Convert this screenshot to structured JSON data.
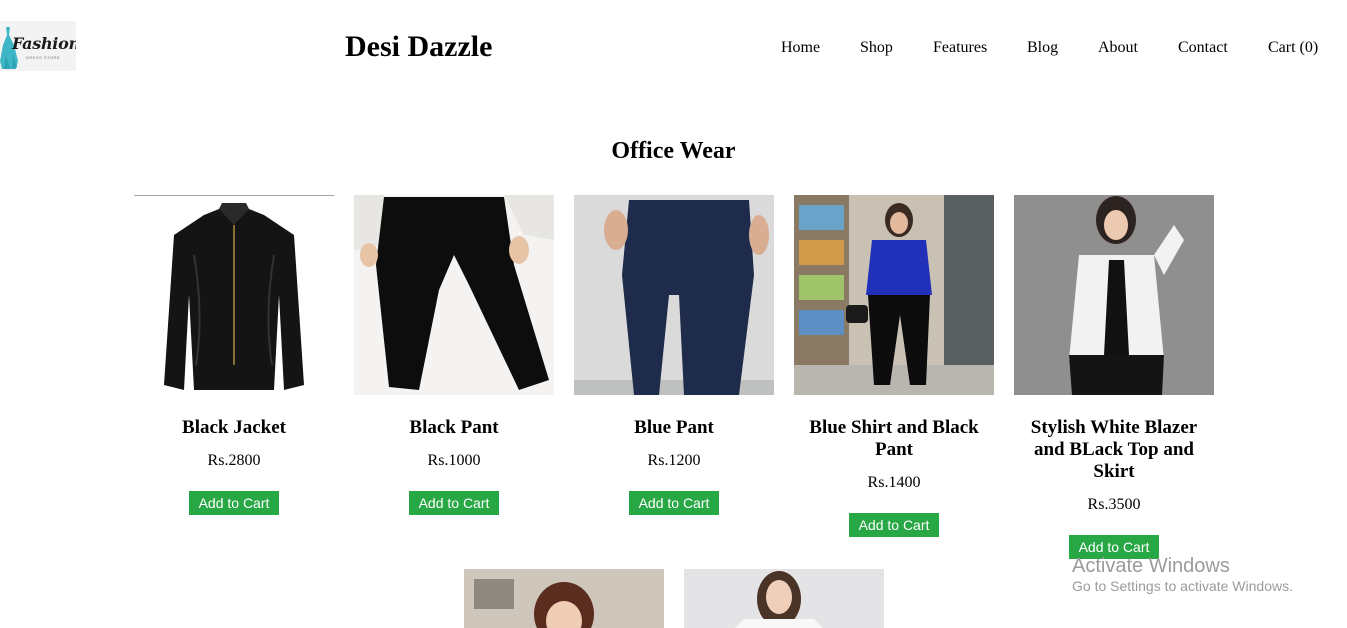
{
  "header": {
    "logo_text": "Fashion",
    "logo_subtext": "DRESS STORE",
    "brand": "Desi Dazzle",
    "nav": [
      {
        "label": "Home"
      },
      {
        "label": "Shop"
      },
      {
        "label": "Features"
      },
      {
        "label": "Blog"
      },
      {
        "label": "About"
      },
      {
        "label": "Contact"
      },
      {
        "label": "Cart (0)"
      }
    ]
  },
  "section": {
    "title": "Office Wear",
    "products": [
      {
        "name": "Black Jacket",
        "price": "Rs.2800",
        "button": "Add to Cart"
      },
      {
        "name": "Black Pant",
        "price": "Rs.1000",
        "button": "Add to Cart"
      },
      {
        "name": "Blue Pant",
        "price": "Rs.1200",
        "button": "Add to Cart"
      },
      {
        "name": "Blue Shirt and Black Pant",
        "price": "Rs.1400",
        "button": "Add to Cart"
      },
      {
        "name": "Stylish White Blazer and BLack Top and Skirt",
        "price": "Rs.3500",
        "button": "Add to Cart"
      }
    ]
  },
  "watermark": {
    "title": "Activate Windows",
    "subtitle": "Go to Settings to activate Windows."
  },
  "colors": {
    "button_bg": "#28a745",
    "button_text": "#ffffff",
    "watermark_text": "#9b9b9b"
  }
}
